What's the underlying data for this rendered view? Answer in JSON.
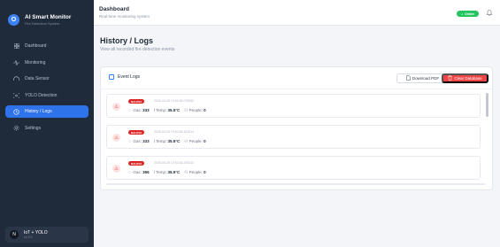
{
  "brand": {
    "title": "AI Smart Monitor",
    "subtitle": "Fire Detection System",
    "logo_letter": "O"
  },
  "sidebar": {
    "items": [
      {
        "label": "Dashboard",
        "icon": "grid-icon"
      },
      {
        "label": "Monitoring",
        "icon": "activity-icon"
      },
      {
        "label": "Data Sensor",
        "icon": "gauge-icon"
      },
      {
        "label": "YOLO Detection",
        "icon": "scan-icon"
      },
      {
        "label": "History / Logs",
        "icon": "history-icon",
        "active": true
      },
      {
        "label": "Settings",
        "icon": "gear-icon"
      }
    ],
    "footer": {
      "avatar": "N",
      "title": "IoT + YOLO",
      "subtitle": "v1.0.0"
    }
  },
  "header": {
    "title": "Dashboard",
    "subtitle": "Real-time monitoring system",
    "status": "Online"
  },
  "page": {
    "title": "History / Logs",
    "subtitle": "View all recorded fire detection events"
  },
  "card": {
    "title": "Event Logs",
    "download_label": "Download PDF",
    "clear_label": "Clear Database"
  },
  "logs": [
    {
      "badge": "BAHAYA",
      "timestamp": "2026-04-25 10:53:36.076060",
      "gas_label": "Gas:",
      "gas": "333",
      "temp_label": "Temp:",
      "temp": "35.5°C",
      "people_label": "People:",
      "people": "0"
    },
    {
      "badge": "BAHAYA",
      "timestamp": "2026-04-25 10:53:36.452614",
      "gas_label": "Gas:",
      "gas": "333",
      "temp_label": "Temp:",
      "temp": "35.5°C",
      "people_label": "People:",
      "people": "0"
    },
    {
      "badge": "BAHAYA",
      "timestamp": "2026-04-25 10:53:36.205242",
      "gas_label": "Gas:",
      "gas": "356",
      "temp_label": "Temp:",
      "temp": "35.5°C",
      "people_label": "People:",
      "people": "0"
    }
  ],
  "colors": {
    "sidebar_bg": "#1f2a3a",
    "accent": "#2f73ea",
    "danger": "#ef4444",
    "online": "#22c55e"
  }
}
